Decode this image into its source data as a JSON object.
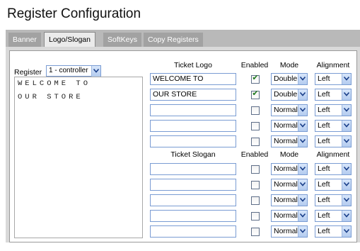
{
  "page": {
    "title": "Register Configuration"
  },
  "tabs": [
    {
      "label": "Banner",
      "active": false
    },
    {
      "label": "Logo/Slogan",
      "active": true
    },
    {
      "label": "SoftKeys",
      "active": false
    },
    {
      "label": "Copy Registers",
      "active": false
    }
  ],
  "register": {
    "label": "Register",
    "selected": "1 - controller"
  },
  "preview": {
    "lines": [
      "WELCOME TO",
      "OUR STORE"
    ]
  },
  "logo": {
    "headers": {
      "text": "Ticket Logo",
      "enabled": "Enabled",
      "mode": "Mode",
      "alignment": "Alignment"
    },
    "rows": [
      {
        "text": "WELCOME TO",
        "enabled": true,
        "mode": "Double",
        "alignment": "Left"
      },
      {
        "text": "OUR STORE",
        "enabled": true,
        "mode": "Double",
        "alignment": "Left"
      },
      {
        "text": "",
        "enabled": false,
        "mode": "Normal",
        "alignment": "Left"
      },
      {
        "text": "",
        "enabled": false,
        "mode": "Normal",
        "alignment": "Left"
      },
      {
        "text": "",
        "enabled": false,
        "mode": "Normal",
        "alignment": "Left"
      }
    ]
  },
  "slogan": {
    "headers": {
      "text": "Ticket Slogan",
      "enabled": "Enabled",
      "mode": "Mode",
      "alignment": "Alignment"
    },
    "rows": [
      {
        "text": "",
        "enabled": false,
        "mode": "Normal",
        "alignment": "Left"
      },
      {
        "text": "",
        "enabled": false,
        "mode": "Normal",
        "alignment": "Left"
      },
      {
        "text": "",
        "enabled": false,
        "mode": "Normal",
        "alignment": "Left"
      },
      {
        "text": "",
        "enabled": false,
        "mode": "Normal",
        "alignment": "Left"
      },
      {
        "text": "",
        "enabled": false,
        "mode": "Normal",
        "alignment": "Left"
      }
    ]
  },
  "icons": {
    "dropdown": "chevron-down-icon",
    "check": "check-icon"
  }
}
